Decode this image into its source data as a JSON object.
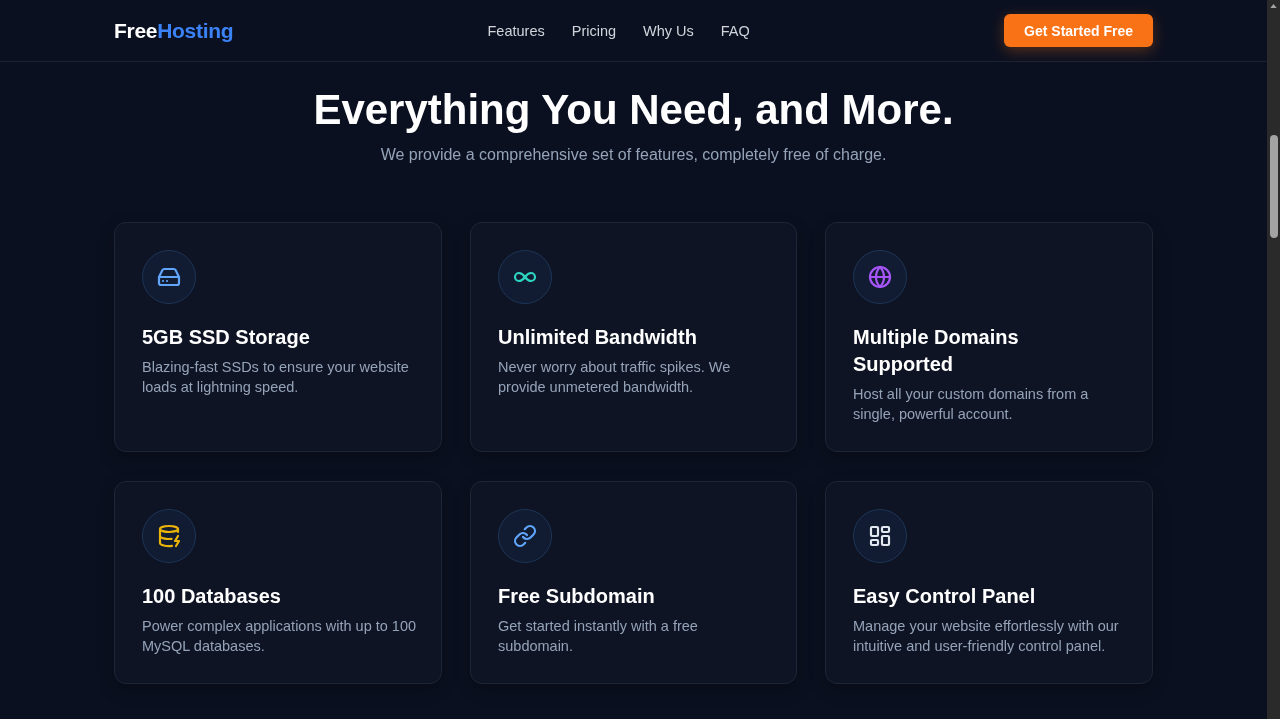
{
  "header": {
    "logo": {
      "lead": "Free",
      "accent": "Hosting"
    },
    "nav": [
      {
        "label": "Features"
      },
      {
        "label": "Pricing"
      },
      {
        "label": "Why Us"
      },
      {
        "label": "FAQ"
      }
    ],
    "cta": "Get Started Free"
  },
  "hero": {
    "title": "Everything You Need, and More.",
    "subtitle": "We provide a comprehensive set of features, completely free of charge."
  },
  "features": [
    {
      "kind": "storage",
      "color": "#60a5fa",
      "title": "5GB SSD Storage",
      "description": "Blazing-fast SSDs to ensure your website loads at lightning speed."
    },
    {
      "kind": "bandwidth",
      "color": "#2dd4bf",
      "title": "Unlimited Bandwidth",
      "description": "Never worry about traffic spikes. We provide unmetered bandwidth."
    },
    {
      "kind": "domains",
      "color": "#a855f7",
      "title": "Multiple Domains Supported",
      "description": "Host all your custom domains from a single, powerful account."
    },
    {
      "kind": "databases",
      "color": "#eab308",
      "title": "100 Databases",
      "description": "Power complex applications with up to 100 MySQL databases."
    },
    {
      "kind": "subdomain",
      "color": "#60a5fa",
      "title": "Free Subdomain",
      "description": "Get started instantly with a free subdomain."
    },
    {
      "kind": "panel",
      "color": "#e2e8f0",
      "title": "Easy Control Panel",
      "description": "Manage your website effortlessly with our intuitive and user-friendly control panel."
    }
  ]
}
